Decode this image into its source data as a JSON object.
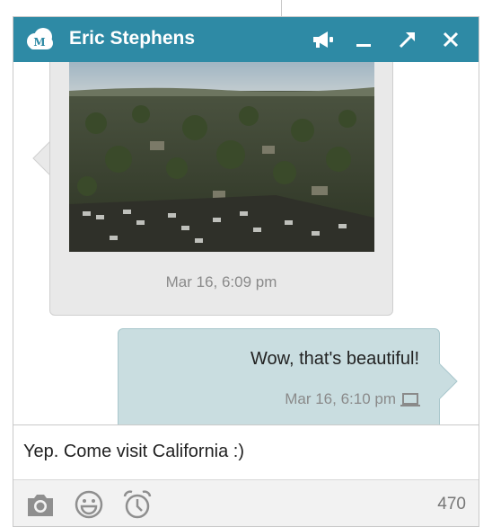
{
  "window": {
    "title": "Eric Stephens",
    "header_color": "#2e8aa5"
  },
  "titlebar_icons": [
    "announce-icon",
    "minimize-icon",
    "expand-icon",
    "close-icon"
  ],
  "messages": [
    {
      "direction": "incoming",
      "attachment": "photo",
      "timestamp": "Mar 16, 6:09 pm"
    },
    {
      "direction": "outgoing",
      "text": "Wow, that's beautiful!",
      "timestamp": "Mar 16, 6:10 pm",
      "status_icon": "laptop-icon"
    }
  ],
  "composer": {
    "value": "Yep.  Come visit California :)"
  },
  "toolbar": {
    "icons": [
      "camera-icon",
      "emoji-icon",
      "alarm-clock-icon"
    ],
    "char_count": "470"
  }
}
